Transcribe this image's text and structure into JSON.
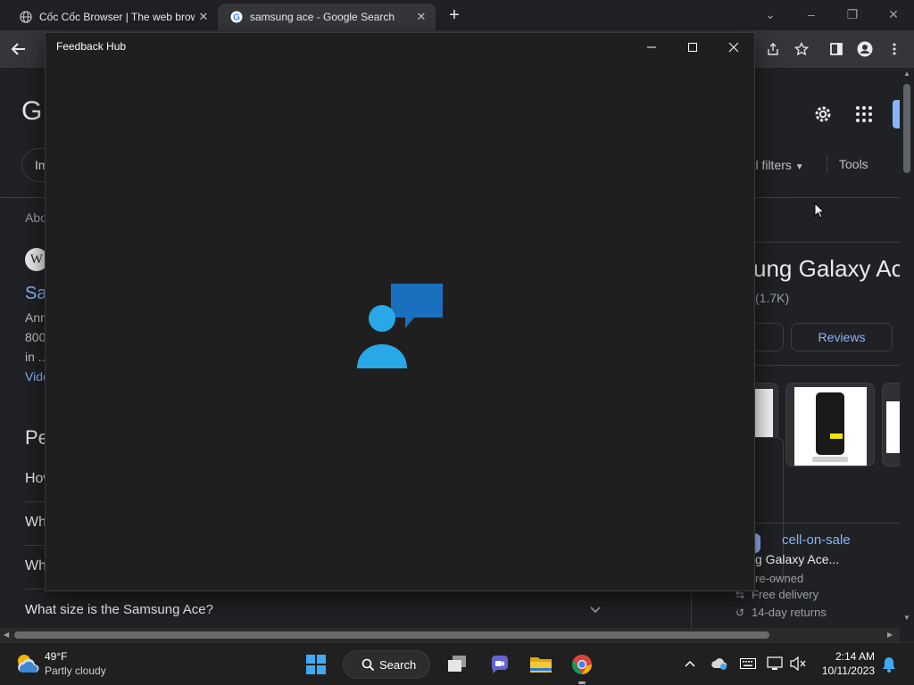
{
  "browser": {
    "tabs": [
      {
        "title": "Cốc Cốc Browser | The web brow",
        "active": false,
        "favicon": "globe-icon"
      },
      {
        "title": "samsung ace - Google Search",
        "active": true,
        "favicon": "google-g-icon"
      }
    ]
  },
  "google_page": {
    "logo_partial": "G",
    "chip_partial": "Im",
    "filters_label": "All filters",
    "tools_label": "Tools",
    "results_count_partial": "Abo",
    "wiki_icon_letter": "W",
    "result_title_partial": "Sa",
    "snippet_lines": [
      "Ann",
      "800",
      "in ..."
    ],
    "video_link_partial": "Vide",
    "people_also_ask_partial": "Pe",
    "paa_partials": [
      "How",
      "Wha",
      "Wha"
    ],
    "paa_full": "What size is the Samsung Ace?",
    "panel_title_partial": "ung Galaxy Ac",
    "panel_rating_partial": "(1.7K)",
    "reviews_button": "Reviews",
    "seller_link_partial": "cell-on-sale",
    "seller_product_partial": "g Galaxy Ace...",
    "owned_partial": "re-owned",
    "free_delivery": "Free delivery",
    "returns": "14-day returns"
  },
  "feedback_hub": {
    "title": "Feedback Hub",
    "colors": {
      "person": "#29a8e8",
      "bubble": "#1a6fbf",
      "background": "#1f1f1f"
    }
  },
  "taskbar": {
    "weather_temp": "49°F",
    "weather_desc": "Partly cloudy",
    "search_label": "Search",
    "time": "2:14 AM",
    "date": "10/11/2023"
  }
}
